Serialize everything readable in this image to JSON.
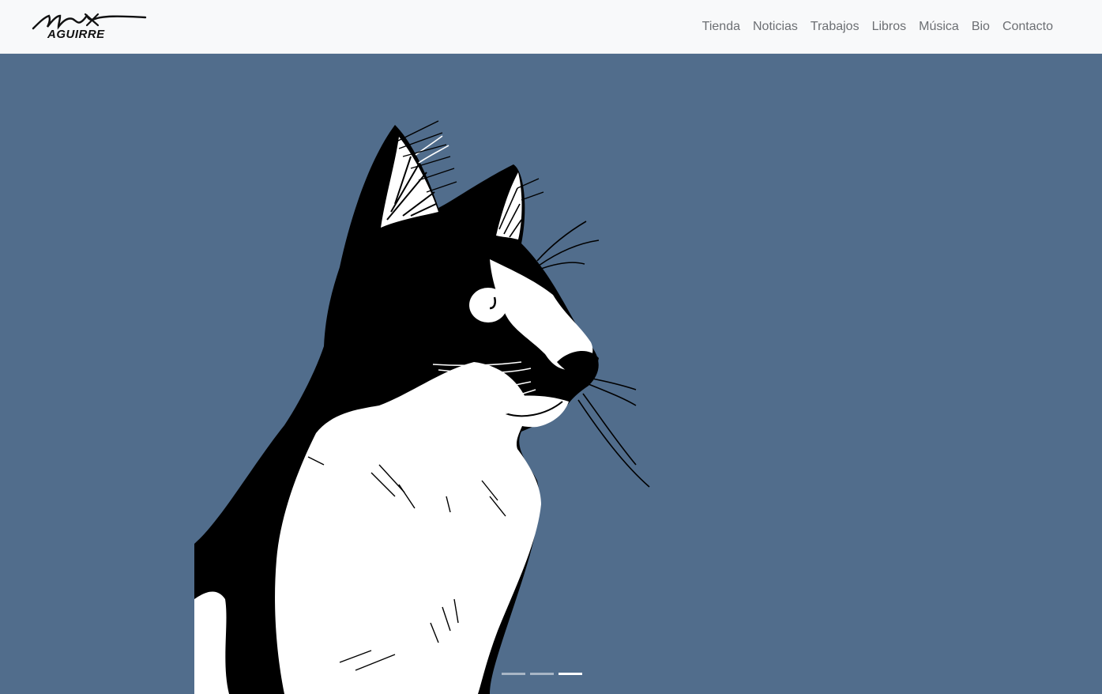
{
  "brand": {
    "logo_text_top": "Max",
    "logo_text_bottom": "AGUIRRE"
  },
  "nav": {
    "items": [
      {
        "label": "Tienda"
      },
      {
        "label": "Noticias"
      },
      {
        "label": "Trabajos"
      },
      {
        "label": "Libros"
      },
      {
        "label": "Música"
      },
      {
        "label": "Bio"
      },
      {
        "label": "Contacto"
      }
    ]
  },
  "carousel": {
    "background_color": "#516d8c",
    "slide_count": 3,
    "active_slide": 3
  },
  "colors": {
    "navbar_bg": "#f8f9fa",
    "nav_text": "#6c6f73",
    "hero_bg": "#516d8c"
  }
}
